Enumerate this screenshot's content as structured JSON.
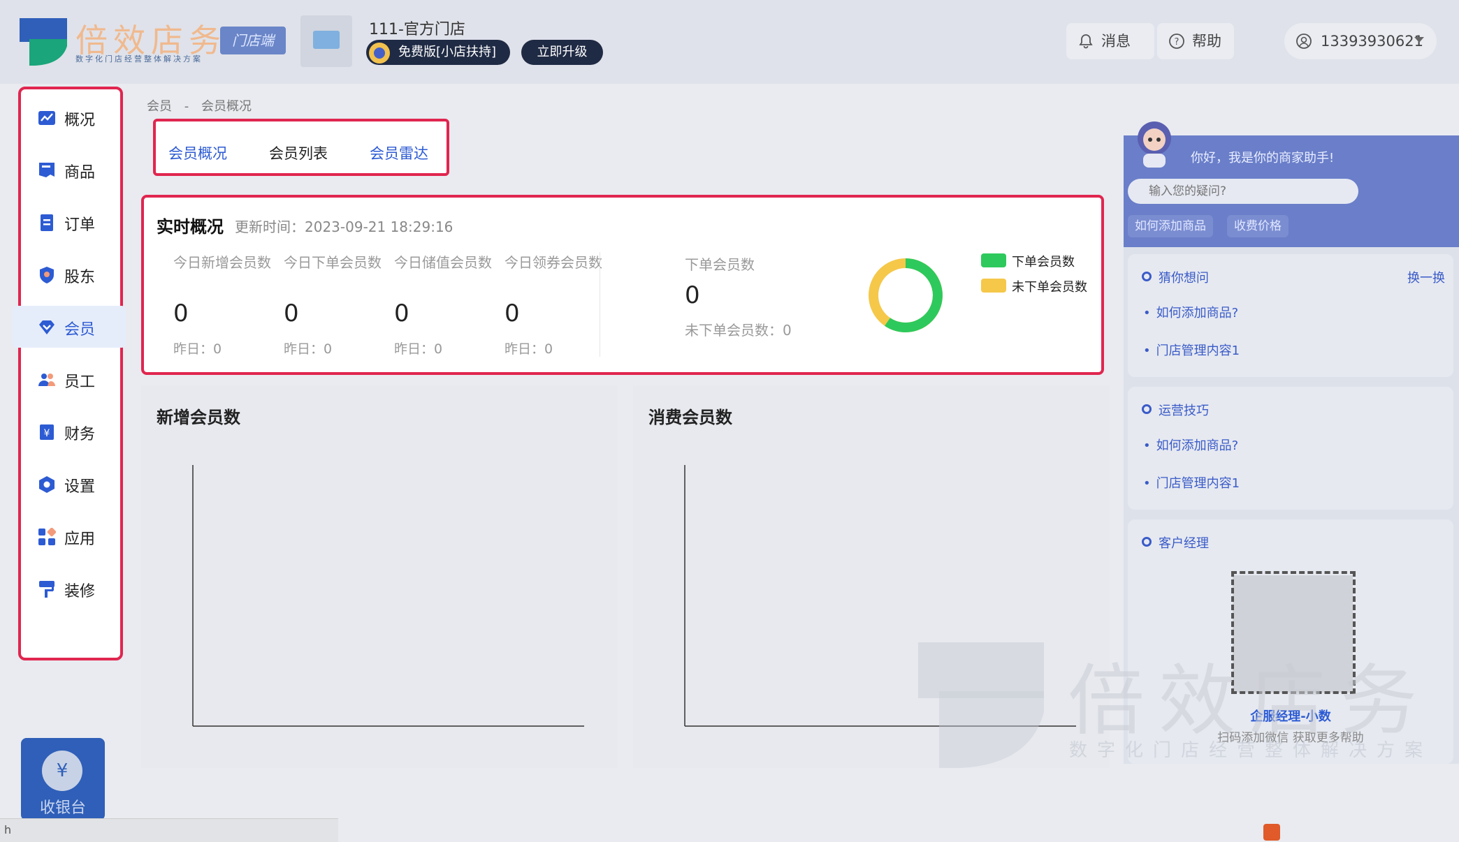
{
  "header": {
    "logo_text": "倍效店务",
    "logo_sub": "数字化门店经营整体解决方案",
    "badge": "门店端",
    "store_name": "111-官方门店",
    "plan": "免费版[小店扶持]",
    "upgrade": "立即升级",
    "messages": "消息",
    "help": "帮助",
    "user": "13393930621"
  },
  "sidebar": {
    "items": [
      {
        "label": "概况",
        "icon": "chart-icon"
      },
      {
        "label": "商品",
        "icon": "goods-icon"
      },
      {
        "label": "订单",
        "icon": "order-icon"
      },
      {
        "label": "股东",
        "icon": "shareholder-icon"
      },
      {
        "label": "会员",
        "icon": "member-icon",
        "active": true
      },
      {
        "label": "员工",
        "icon": "staff-icon"
      },
      {
        "label": "财务",
        "icon": "finance-icon"
      },
      {
        "label": "设置",
        "icon": "settings-icon"
      },
      {
        "label": "应用",
        "icon": "apps-icon"
      },
      {
        "label": "装修",
        "icon": "decorate-icon"
      }
    ],
    "cashier": "收银台"
  },
  "breadcrumb": [
    "会员",
    "-",
    "会员概况"
  ],
  "tabs": [
    {
      "label": "会员概况"
    },
    {
      "label": "会员列表"
    },
    {
      "label": "会员雷达"
    }
  ],
  "overview": {
    "title": "实时概况",
    "updated": "更新时间：2023-09-21 18:29:16",
    "stats": [
      {
        "name": "今日新增会员数",
        "value": "0",
        "prev": "昨日：0"
      },
      {
        "name": "今日下单会员数",
        "value": "0",
        "prev": "昨日：0"
      },
      {
        "name": "今日储值会员数",
        "value": "0",
        "prev": "昨日：0"
      },
      {
        "name": "今日领券会员数",
        "value": "0",
        "prev": "昨日：0"
      }
    ],
    "order_members_label": "下单会员数",
    "order_members_value": "0",
    "non_order_label": "未下单会员数：0",
    "legend": [
      {
        "label": "下单会员数",
        "color": "#2ec95c"
      },
      {
        "label": "未下单会员数",
        "color": "#f5c84a"
      }
    ]
  },
  "charts": {
    "new_members_title": "新增会员数",
    "spending_members_title": "消费会员数"
  },
  "assistant": {
    "greeting": "你好，我是你的商家助手!",
    "input_placeholder": "输入您的疑问?",
    "chips": [
      "如何添加商品",
      "收费价格"
    ],
    "guess": {
      "title": "猜你想问",
      "swap": "换一换",
      "links": [
        "如何添加商品?",
        "门店管理内容1"
      ]
    },
    "tips": {
      "title": "运营技巧",
      "links": [
        "如何添加商品?",
        "门店管理内容1"
      ]
    },
    "manager": {
      "title": "客户经理",
      "name": "企服经理-小数",
      "tip": "扫码添加微信 获取更多帮助"
    }
  },
  "watermark": {
    "text": "倍效店务",
    "sub": "数字化门店经营整体解决方案"
  },
  "statusbar": "h",
  "colors": {
    "accent": "#2d5bd3",
    "highlight_border": "#e0264f",
    "green": "#2ec95c",
    "yellow": "#f5c84a"
  }
}
